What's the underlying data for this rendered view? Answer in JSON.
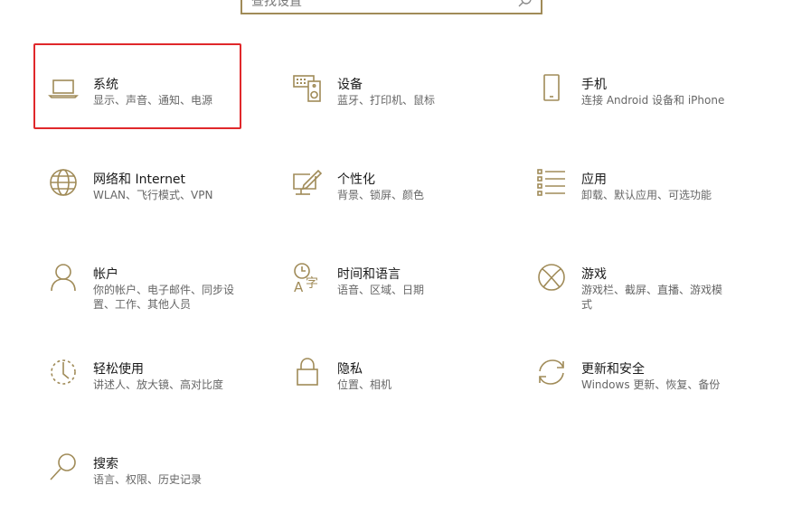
{
  "search": {
    "placeholder": "查找设置"
  },
  "tiles": [
    {
      "title": "系统",
      "desc": "显示、声音、通知、电源",
      "icon": "laptop-icon"
    },
    {
      "title": "设备",
      "desc": "蓝牙、打印机、鼠标",
      "icon": "keyboard-speaker-icon"
    },
    {
      "title": "手机",
      "desc": "连接 Android 设备和 iPhone",
      "icon": "phone-icon"
    },
    {
      "title": "网络和 Internet",
      "desc": "WLAN、飞行模式、VPN",
      "icon": "globe-icon"
    },
    {
      "title": "个性化",
      "desc": "背景、锁屏、颜色",
      "icon": "paint-icon"
    },
    {
      "title": "应用",
      "desc": "卸载、默认应用、可选功能",
      "icon": "apps-list-icon"
    },
    {
      "title": "帐户",
      "desc": "你的帐户、电子邮件、同步设置、工作、其他人员",
      "icon": "person-icon"
    },
    {
      "title": "时间和语言",
      "desc": "语音、区域、日期",
      "icon": "time-language-icon"
    },
    {
      "title": "游戏",
      "desc": "游戏栏、截屏、直播、游戏模式",
      "icon": "xbox-icon"
    },
    {
      "title": "轻松使用",
      "desc": "讲述人、放大镜、高对比度",
      "icon": "ease-of-access-icon"
    },
    {
      "title": "隐私",
      "desc": "位置、相机",
      "icon": "lock-icon"
    },
    {
      "title": "更新和安全",
      "desc": "Windows 更新、恢复、备份",
      "icon": "update-icon"
    },
    {
      "title": "搜索",
      "desc": "语言、权限、历史记录",
      "icon": "search-icon"
    }
  ],
  "colors": {
    "icon": "#a08b58",
    "selection": "#e0282b"
  }
}
